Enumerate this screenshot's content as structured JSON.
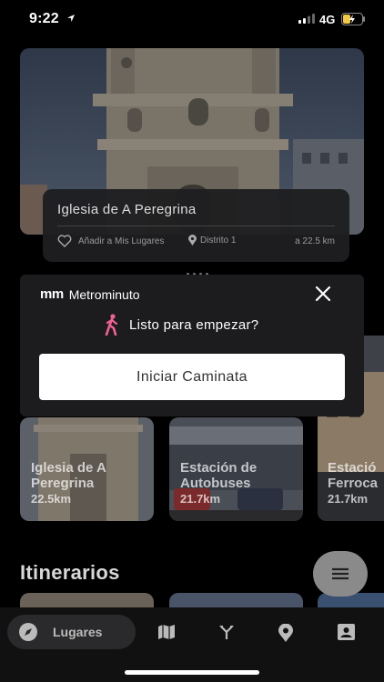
{
  "status": {
    "time": "9:22",
    "network": "4G"
  },
  "hero": {
    "title": "Iglesia de A Peregrina",
    "favorite_label": "Añadir a Mis Lugares",
    "district": "Distrito 1",
    "distance": "a 22.5 km"
  },
  "modal": {
    "brand_logo": "mm",
    "brand_name": "Metrominuto",
    "prompt": "Listo para empezar?",
    "start_button": "Iniciar Caminata"
  },
  "places": [
    {
      "line1": "Iglesia de A",
      "line2": "Peregrina",
      "distance": "22.5km"
    },
    {
      "line1": "Estación de",
      "line2": "Autobuses",
      "distance": "21.7km"
    },
    {
      "line1": "Estació",
      "line2": "Ferroca",
      "distance": "21.7km"
    }
  ],
  "itinerarios_title": "Itinerarios",
  "nav": {
    "active_label": "Lugares"
  },
  "colors": {
    "accent_pink": "#f06292",
    "modal_bg": "#1c1c1e",
    "card_bg": "#1e1e20"
  },
  "icons": [
    "location-arrow-icon",
    "signal-icon",
    "battery-icon",
    "heart-icon",
    "pin-icon",
    "close-icon",
    "walking-icon",
    "menu-icon",
    "compass-icon",
    "map-icon",
    "route-icon",
    "place-pin-icon",
    "profile-icon"
  ]
}
